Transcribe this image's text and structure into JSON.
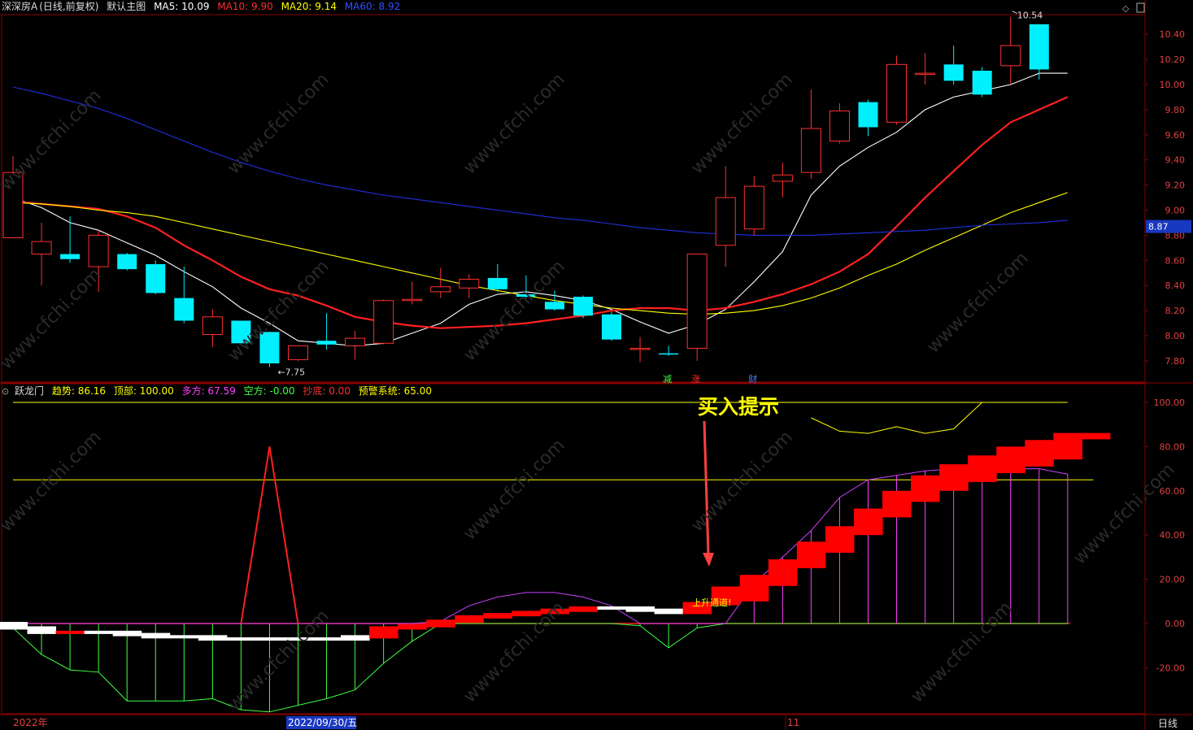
{
  "header_top": {
    "stock": "深深房A",
    "adjust": "(日线,前复权)",
    "template": "默认主图",
    "ma5": "MA5: 10.09",
    "ma10": "MA10: 9.90",
    "ma20": "MA20: 9.14",
    "ma60": "MA60: 8.92",
    "colors": {
      "ma5": "#ffffff",
      "ma10": "#ff3030",
      "ma20": "#ffff00",
      "ma60": "#3050ff"
    }
  },
  "header_bottom": {
    "indicator": "跃龙门",
    "trend": "趋势: 86.16",
    "top": "顶部: 100.00",
    "long": "多方: 67.59",
    "short": "空方: -0.00",
    "bottom": "抄底: 0.00",
    "warn": "预警系统: 65.00",
    "colors": {
      "trend": "#ffff00",
      "top": "#ffff00",
      "long": "#ff40ff",
      "short": "#40ff40",
      "bottom": "#ff3030",
      "warn": "#ffff00"
    }
  },
  "annotations": {
    "buy_hint": "买入提示",
    "rise_channel": "上升通道!",
    "high_label": "10.54",
    "low_label": "7.75",
    "price_tag": "8.87",
    "event_marks": [
      "减",
      "涨",
      "财"
    ]
  },
  "time_axis": {
    "labels": [
      "2022年",
      "2022/09/30/五",
      "11"
    ],
    "period": "日线"
  },
  "watermark": "www.cfchi.com",
  "chart_data": [
    {
      "type": "candlestick",
      "title": "深深房A",
      "y_ticks": [
        10.4,
        10.2,
        10.0,
        9.8,
        9.6,
        9.4,
        9.2,
        9.0,
        8.8,
        8.6,
        8.4,
        8.2,
        8.0,
        7.8
      ],
      "ylim": [
        7.6,
        10.6
      ],
      "candles": [
        {
          "o": 8.78,
          "c": 9.3,
          "h": 9.43,
          "l": 8.78
        },
        {
          "o": 8.65,
          "c": 8.75,
          "h": 8.9,
          "l": 8.4
        },
        {
          "o": 8.65,
          "c": 8.61,
          "h": 8.95,
          "l": 8.58
        },
        {
          "o": 8.55,
          "c": 8.8,
          "h": 8.84,
          "l": 8.35
        },
        {
          "o": 8.65,
          "c": 8.53,
          "h": 8.66,
          "l": 8.52
        },
        {
          "o": 8.57,
          "c": 8.34,
          "h": 8.6,
          "l": 8.33
        },
        {
          "o": 8.3,
          "c": 8.12,
          "h": 8.55,
          "l": 8.1
        },
        {
          "o": 8.01,
          "c": 8.15,
          "h": 8.21,
          "l": 7.91
        },
        {
          "o": 8.12,
          "c": 7.94,
          "h": 8.12,
          "l": 7.94
        },
        {
          "o": 8.03,
          "c": 7.78,
          "h": 8.03,
          "l": 7.75
        },
        {
          "o": 7.81,
          "c": 7.92,
          "h": 7.92,
          "l": 7.8
        },
        {
          "o": 7.96,
          "c": 7.93,
          "h": 8.18,
          "l": 7.89
        },
        {
          "o": 7.92,
          "c": 7.98,
          "h": 8.04,
          "l": 7.81
        },
        {
          "o": 7.94,
          "c": 8.28,
          "h": 8.29,
          "l": 7.93
        },
        {
          "o": 8.28,
          "c": 8.29,
          "h": 8.43,
          "l": 8.25
        },
        {
          "o": 8.35,
          "c": 8.39,
          "h": 8.54,
          "l": 8.3
        },
        {
          "o": 8.38,
          "c": 8.45,
          "h": 8.49,
          "l": 8.3
        },
        {
          "o": 8.46,
          "c": 8.37,
          "h": 8.57,
          "l": 8.35
        },
        {
          "o": 8.33,
          "c": 8.31,
          "h": 8.48,
          "l": 8.3
        },
        {
          "o": 8.27,
          "c": 8.21,
          "h": 8.36,
          "l": 8.2
        },
        {
          "o": 8.31,
          "c": 8.16,
          "h": 8.32,
          "l": 8.14
        },
        {
          "o": 8.17,
          "c": 7.97,
          "h": 8.19,
          "l": 7.96
        },
        {
          "o": 7.89,
          "c": 7.9,
          "h": 7.99,
          "l": 7.79
        },
        {
          "o": 7.86,
          "c": 7.85,
          "h": 7.92,
          "l": 7.84
        },
        {
          "o": 7.9,
          "c": 8.65,
          "h": 8.65,
          "l": 7.8
        },
        {
          "o": 8.72,
          "c": 9.1,
          "h": 9.35,
          "l": 8.55
        },
        {
          "o": 8.85,
          "c": 9.19,
          "h": 9.27,
          "l": 8.8
        },
        {
          "o": 9.23,
          "c": 9.28,
          "h": 9.38,
          "l": 9.1
        },
        {
          "o": 9.3,
          "c": 9.65,
          "h": 9.96,
          "l": 9.25
        },
        {
          "o": 9.55,
          "c": 9.79,
          "h": 9.85,
          "l": 9.53
        },
        {
          "o": 9.86,
          "c": 9.66,
          "h": 9.88,
          "l": 9.59
        },
        {
          "o": 9.7,
          "c": 10.16,
          "h": 10.23,
          "l": 9.68
        },
        {
          "o": 10.08,
          "c": 10.09,
          "h": 10.25,
          "l": 10.0
        },
        {
          "o": 10.16,
          "c": 10.03,
          "h": 10.31,
          "l": 10.0
        },
        {
          "o": 10.11,
          "c": 9.92,
          "h": 10.14,
          "l": 9.9
        },
        {
          "o": 10.15,
          "c": 10.31,
          "h": 10.54,
          "l": 10.0
        },
        {
          "o": 10.48,
          "c": 10.12,
          "h": 10.48,
          "l": 10.04
        }
      ],
      "series": [
        {
          "name": "MA5",
          "color": "#ffffff",
          "values": [
            9.1,
            9.02,
            8.9,
            8.84,
            8.74,
            8.64,
            8.51,
            8.39,
            8.22,
            8.1,
            7.96,
            7.94,
            7.92,
            7.94,
            8.02,
            8.1,
            8.25,
            8.33,
            8.35,
            8.32,
            8.28,
            8.21,
            8.11,
            8.02,
            8.09,
            8.21,
            8.43,
            8.67,
            9.12,
            9.35,
            9.5,
            9.62,
            9.8,
            9.9,
            9.95,
            10.0,
            10.09,
            10.09
          ]
        },
        {
          "name": "MA10",
          "color": "#ff2020",
          "values": [
            9.07,
            9.05,
            9.03,
            9.01,
            8.95,
            8.86,
            8.72,
            8.6,
            8.47,
            8.37,
            8.32,
            8.24,
            8.15,
            8.11,
            8.08,
            8.06,
            8.07,
            8.08,
            8.1,
            8.13,
            8.16,
            8.2,
            8.22,
            8.22,
            8.2,
            8.22,
            8.27,
            8.33,
            8.41,
            8.51,
            8.65,
            8.87,
            9.1,
            9.31,
            9.52,
            9.7,
            9.8,
            9.9
          ]
        },
        {
          "name": "MA20",
          "color": "#ffff00",
          "values": [
            9.06,
            9.05,
            9.03,
            9.0,
            8.98,
            8.95,
            8.9,
            8.85,
            8.8,
            8.75,
            8.7,
            8.65,
            8.6,
            8.55,
            8.5,
            8.45,
            8.4,
            8.36,
            8.32,
            8.28,
            8.25,
            8.22,
            8.2,
            8.18,
            8.17,
            8.18,
            8.2,
            8.24,
            8.3,
            8.38,
            8.48,
            8.57,
            8.68,
            8.78,
            8.88,
            8.98,
            9.06,
            9.14
          ]
        },
        {
          "name": "MA60",
          "color": "#2030e0",
          "values": [
            9.98,
            9.93,
            9.87,
            9.81,
            9.73,
            9.64,
            9.55,
            9.46,
            9.38,
            9.31,
            9.25,
            9.2,
            9.16,
            9.12,
            9.09,
            9.06,
            9.03,
            9.0,
            8.97,
            8.94,
            8.92,
            8.89,
            8.86,
            8.84,
            8.82,
            8.81,
            8.8,
            8.8,
            8.8,
            8.81,
            8.82,
            8.83,
            8.84,
            8.86,
            8.88,
            8.89,
            8.9,
            8.92
          ]
        }
      ]
    },
    {
      "type": "indicator",
      "title": "跃龙门",
      "y_ticks": [
        100.0,
        80.0,
        60.0,
        40.0,
        20.0,
        0.0,
        -20.0
      ],
      "ylim": [
        -40,
        105
      ],
      "hlines": [
        100,
        65
      ],
      "long_purple": [
        0,
        0,
        0,
        0,
        0,
        0,
        0,
        0,
        0,
        0,
        0,
        0,
        0,
        0,
        0,
        1,
        8,
        12,
        14,
        14,
        12,
        8,
        0,
        0,
        0,
        0,
        18,
        30,
        42,
        57,
        65,
        67,
        69,
        70,
        70,
        70,
        70,
        67.59
      ],
      "short_green": [
        -2,
        -14,
        -21,
        -22,
        -35,
        -35,
        -35,
        -34,
        -39,
        -40,
        -37,
        -34,
        -30,
        -18,
        -8,
        0,
        0,
        0,
        0,
        0,
        0,
        0,
        -1,
        -11,
        -2,
        0,
        0,
        0,
        0,
        0,
        0,
        0,
        0,
        0,
        0,
        0,
        0,
        0
      ],
      "bottom_red_spike": {
        "index": 9,
        "value": 80
      },
      "trend_top_line": [
        null,
        null,
        null,
        null,
        null,
        null,
        null,
        null,
        null,
        null,
        null,
        null,
        null,
        null,
        null,
        null,
        null,
        null,
        null,
        null,
        null,
        null,
        null,
        null,
        null,
        null,
        null,
        null,
        93,
        87,
        86,
        89,
        86,
        88,
        100,
        100,
        100,
        100
      ],
      "trend_bars": [
        {
          "color": "white",
          "v": -2
        },
        {
          "color": "white",
          "v": -4
        },
        {
          "color": "red",
          "v": -4
        },
        {
          "color": "white",
          "v": -4
        },
        {
          "color": "white",
          "v": -5
        },
        {
          "color": "white",
          "v": -6
        },
        {
          "color": "white",
          "v": -6
        },
        {
          "color": "white",
          "v": -7
        },
        {
          "color": "white",
          "v": -7
        },
        {
          "color": "white",
          "v": -7
        },
        {
          "color": "white",
          "v": -7
        },
        {
          "color": "white",
          "v": -7
        },
        {
          "color": "white",
          "v": -6
        },
        {
          "color": "red",
          "v": -2
        },
        {
          "color": "red",
          "v": -1
        },
        {
          "color": "red",
          "v": 1
        },
        {
          "color": "red",
          "v": 3
        },
        {
          "color": "red",
          "v": 4
        },
        {
          "color": "red",
          "v": 5
        },
        {
          "color": "red",
          "v": 6
        },
        {
          "color": "red",
          "v": 7
        },
        {
          "color": "white",
          "v": 7
        },
        {
          "color": "white",
          "v": 6
        },
        {
          "color": "white",
          "v": 5
        },
        {
          "color": "red",
          "v": 9
        },
        {
          "color": "red",
          "v": 16
        },
        {
          "color": "red",
          "v": 22
        },
        {
          "color": "red",
          "v": 29
        },
        {
          "color": "red",
          "v": 37
        },
        {
          "color": "red",
          "v": 44
        },
        {
          "color": "red",
          "v": 52
        },
        {
          "color": "red",
          "v": 60
        },
        {
          "color": "red",
          "v": 67
        },
        {
          "color": "red",
          "v": 72
        },
        {
          "color": "red",
          "v": 76
        },
        {
          "color": "red",
          "v": 80
        },
        {
          "color": "red",
          "v": 83
        },
        {
          "color": "red",
          "v": 86.16
        }
      ]
    }
  ]
}
